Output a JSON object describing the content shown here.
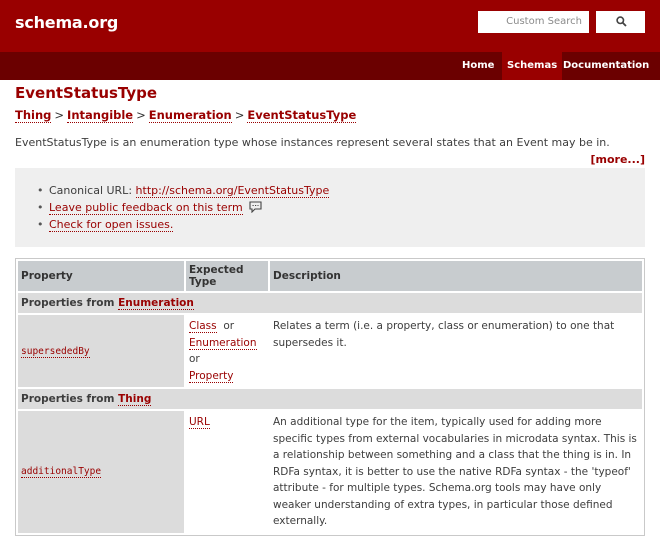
{
  "header": {
    "logo": "schema.org",
    "search_placeholder": "Custom Search",
    "search_icon": "search-icon"
  },
  "nav": {
    "home": "Home",
    "schemas": "Schemas",
    "documentation": "Documentation"
  },
  "page": {
    "title": "EventStatusType",
    "breadcrumb": [
      "Thing",
      "Intangible",
      "Enumeration",
      "EventStatusType"
    ],
    "breadcrumb_sep": ">",
    "description": "EventStatusType is an enumeration type whose instances represent several states that an Event may be in.",
    "more": "[more...]"
  },
  "info": {
    "canonical_label": "Canonical URL:",
    "canonical_url": "http://schema.org/EventStatusType",
    "feedback": "Leave public feedback on this term",
    "issues": "Check for open issues."
  },
  "table": {
    "headers": [
      "Property",
      "Expected Type",
      "Description"
    ],
    "sections": [
      {
        "prefix": "Properties from",
        "type": "Enumeration",
        "rows": [
          {
            "property": "supersededBy",
            "types": [
              "Class",
              "Enumeration",
              "Property"
            ],
            "or": "or",
            "description": "Relates a term (i.e. a property, class or enumeration) to one that supersedes it."
          }
        ]
      },
      {
        "prefix": "Properties from",
        "type": "Thing",
        "rows": [
          {
            "property": "additionalType",
            "types": [
              "URL"
            ],
            "description": "An additional type for the item, typically used for adding more specific types from external vocabularies in microdata syntax. This is a relationship between something and a class that the thing is in. In RDFa syntax, it is better to use the native RDFa syntax - the 'typeof' attribute - for multiple types. Schema.org tools may have only weaker understanding of extra types, in particular those defined externally."
          }
        ]
      }
    ]
  }
}
